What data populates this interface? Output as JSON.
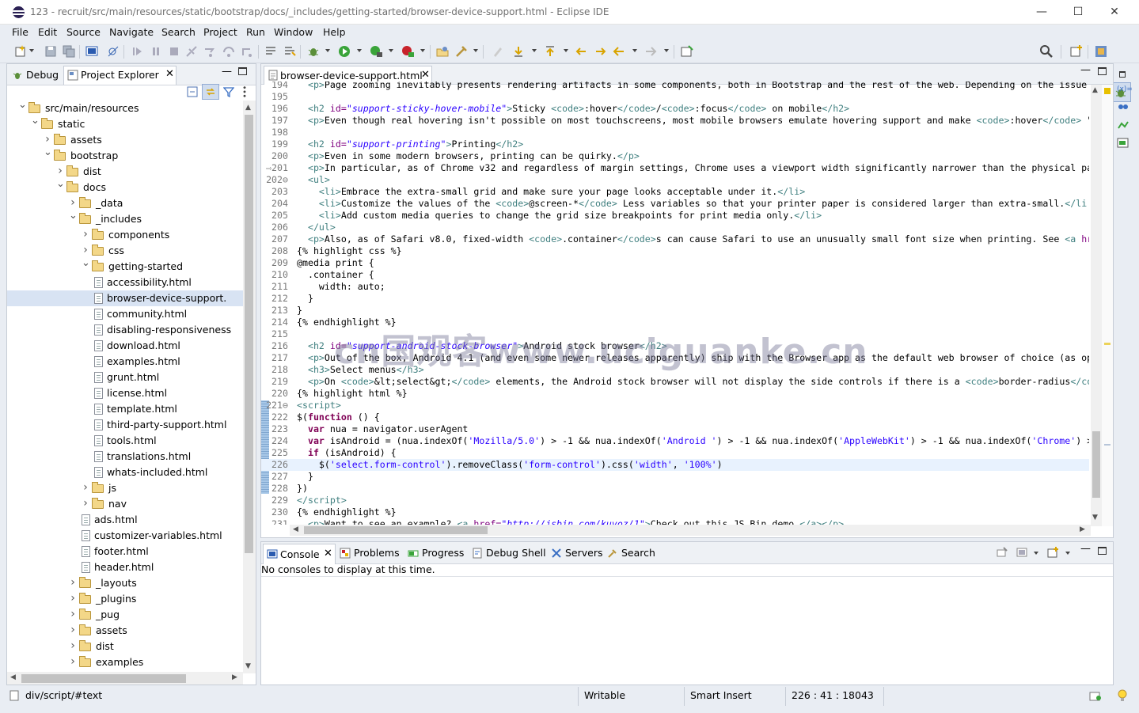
{
  "window": {
    "title": "123 - recruit/src/main/resources/static/bootstrap/docs/_includes/getting-started/browser-device-support.html - Eclipse IDE",
    "minimize": "—",
    "maximize": "☐",
    "close": "✕"
  },
  "menu": [
    "File",
    "Edit",
    "Source",
    "Navigate",
    "Search",
    "Project",
    "Run",
    "Window",
    "Help"
  ],
  "left_panel": {
    "tabs": [
      {
        "label": "Debug"
      },
      {
        "label": "Project Explorer"
      }
    ],
    "tree": [
      {
        "label": "src/main/resources",
        "type": "folder",
        "depth": 1,
        "open": true
      },
      {
        "label": "static",
        "type": "folder",
        "depth": 2,
        "open": true
      },
      {
        "label": "assets",
        "type": "folder",
        "depth": 3,
        "open": false
      },
      {
        "label": "bootstrap",
        "type": "folder",
        "depth": 3,
        "open": true
      },
      {
        "label": "dist",
        "type": "folder",
        "depth": 4,
        "open": false
      },
      {
        "label": "docs",
        "type": "folder",
        "depth": 4,
        "open": true
      },
      {
        "label": "_data",
        "type": "folder",
        "depth": 5,
        "open": false
      },
      {
        "label": "_includes",
        "type": "folder",
        "depth": 5,
        "open": true
      },
      {
        "label": "components",
        "type": "folder",
        "depth": 6,
        "open": false
      },
      {
        "label": "css",
        "type": "folder",
        "depth": 6,
        "open": false
      },
      {
        "label": "getting-started",
        "type": "folder",
        "depth": 6,
        "open": true
      },
      {
        "label": "accessibility.html",
        "type": "file",
        "depth": 7
      },
      {
        "label": "browser-device-support.",
        "type": "file",
        "depth": 7,
        "selected": true
      },
      {
        "label": "community.html",
        "type": "file",
        "depth": 7
      },
      {
        "label": "disabling-responsiveness",
        "type": "file",
        "depth": 7
      },
      {
        "label": "download.html",
        "type": "file",
        "depth": 7
      },
      {
        "label": "examples.html",
        "type": "file",
        "depth": 7
      },
      {
        "label": "grunt.html",
        "type": "file",
        "depth": 7
      },
      {
        "label": "license.html",
        "type": "file",
        "depth": 7
      },
      {
        "label": "template.html",
        "type": "file",
        "depth": 7
      },
      {
        "label": "third-party-support.html",
        "type": "file",
        "depth": 7
      },
      {
        "label": "tools.html",
        "type": "file",
        "depth": 7
      },
      {
        "label": "translations.html",
        "type": "file",
        "depth": 7
      },
      {
        "label": "whats-included.html",
        "type": "file",
        "depth": 7
      },
      {
        "label": "js",
        "type": "folder",
        "depth": 6,
        "open": false
      },
      {
        "label": "nav",
        "type": "folder",
        "depth": 6,
        "open": false
      },
      {
        "label": "ads.html",
        "type": "file",
        "depth": 6
      },
      {
        "label": "customizer-variables.html",
        "type": "file",
        "depth": 6
      },
      {
        "label": "footer.html",
        "type": "file",
        "depth": 6
      },
      {
        "label": "header.html",
        "type": "file",
        "depth": 6
      },
      {
        "label": "_layouts",
        "type": "folder",
        "depth": 5,
        "open": false
      },
      {
        "label": "_plugins",
        "type": "folder",
        "depth": 5,
        "open": false
      },
      {
        "label": "_pug",
        "type": "folder",
        "depth": 5,
        "open": false
      },
      {
        "label": "assets",
        "type": "folder",
        "depth": 5,
        "open": false
      },
      {
        "label": "dist",
        "type": "folder",
        "depth": 5,
        "open": false
      },
      {
        "label": "examples",
        "type": "folder",
        "depth": 5,
        "open": false
      }
    ]
  },
  "editor": {
    "tab_label": "browser-device-support.html",
    "current_line": 226
  },
  "console": {
    "tabs": [
      {
        "label": "Console"
      },
      {
        "label": "Problems"
      },
      {
        "label": "Progress"
      },
      {
        "label": "Debug Shell"
      },
      {
        "label": "Servers"
      },
      {
        "label": "Search"
      }
    ],
    "message": "No consoles to display at this time."
  },
  "status": {
    "path": "div/script/#text",
    "mode": "Writable",
    "insert": "Smart Insert",
    "position": "226 : 41 : 18043"
  },
  "watermark": "cn国观客www.uciguanke.cn",
  "colors": {
    "tag": "#3f7f7f",
    "attr": "#7f007f",
    "string": "#2a00ff",
    "keyword": "#7f0055"
  }
}
